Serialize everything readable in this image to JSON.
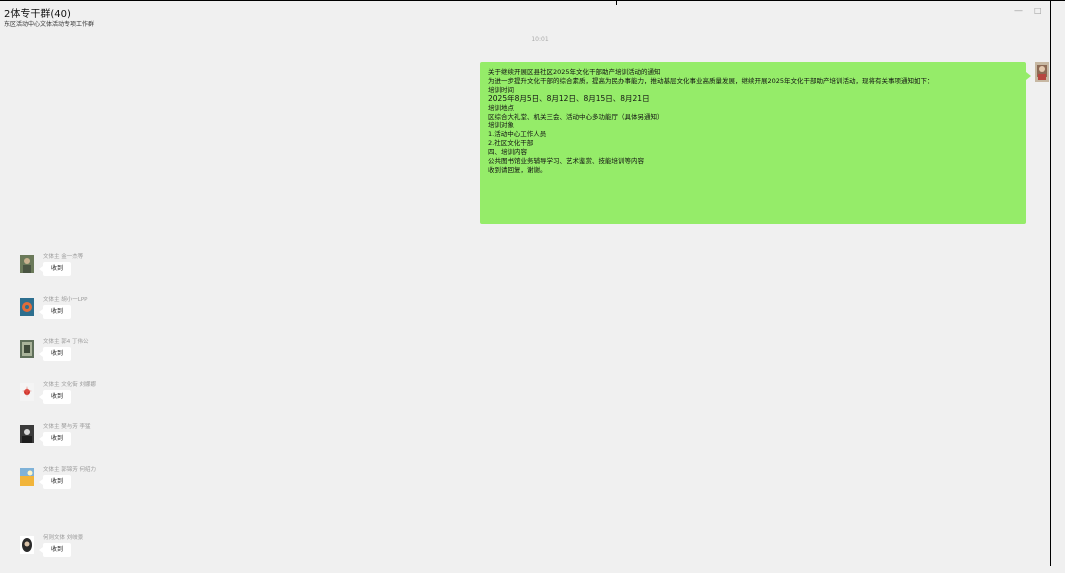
{
  "window": {
    "title": "2体专干群(40)",
    "subtitle": "东区活动中心文体活动专项工作群",
    "minimize_icon": "minimize-icon",
    "maximize_icon": "maximize-icon"
  },
  "chat": {
    "timestamp": "10:01",
    "my_message": {
      "lines": [
        "关于继续开展区县社区2025年文化干部助产培训活动的通知",
        "为进一步提升文化干部的综合素质，提高为民办事能力，推动基层文化事业高质量发展，继续开展2025年文化干部助产培训活动，现将有关事项通知如下：",
        "培训时间",
        "2025年8月5日、8月12日、8月15日、8月21日",
        "培训地点",
        "区综合大礼堂、机关三会、活动中心多功能厅（具体另通知）",
        "培训对象",
        "1.活动中心工作人员",
        "2.社区文化干部",
        "四、培训内容",
        "公共图书馆业务辅导学习、艺术鉴赏、技能培训等内容",
        "收到请回复，谢谢。"
      ]
    },
    "replies": [
      {
        "sender": "文体主 金一杰等",
        "text": "收到",
        "avatar_color": "#6b7a5a",
        "avatar_accent": "#c9b28f"
      },
      {
        "sender": "文体主 胡小一LPP",
        "text": "收到",
        "avatar_color": "#2d6f8f",
        "avatar_accent": "#e06c3a"
      },
      {
        "sender": "文体主 郭4 丁伟公",
        "text": "收到",
        "avatar_color": "#5f6f5a",
        "avatar_accent": "#a9b39a"
      },
      {
        "sender": "文体主 文化街 刘娜娜",
        "text": "收到",
        "avatar_color": "#f4f4f4",
        "avatar_accent": "#d0342c"
      },
      {
        "sender": "文体主 樊与芳 李猛",
        "text": "收到",
        "avatar_color": "#3b3b3b",
        "avatar_accent": "#d8d8d8"
      },
      {
        "sender": "文体主 郭锦芳 何绍力",
        "text": "收到",
        "avatar_color": "#f1b43a",
        "avatar_accent": "#7fb2d8"
      },
      {
        "sender": "何则文体 刘岐景",
        "text": "收到",
        "avatar_color": "#2a2a2a",
        "avatar_accent": "#d9c2a8"
      }
    ]
  },
  "colors": {
    "my_bubble": "#95ec69",
    "background": "#f0f0f0",
    "reply_bubble": "#ffffff"
  }
}
